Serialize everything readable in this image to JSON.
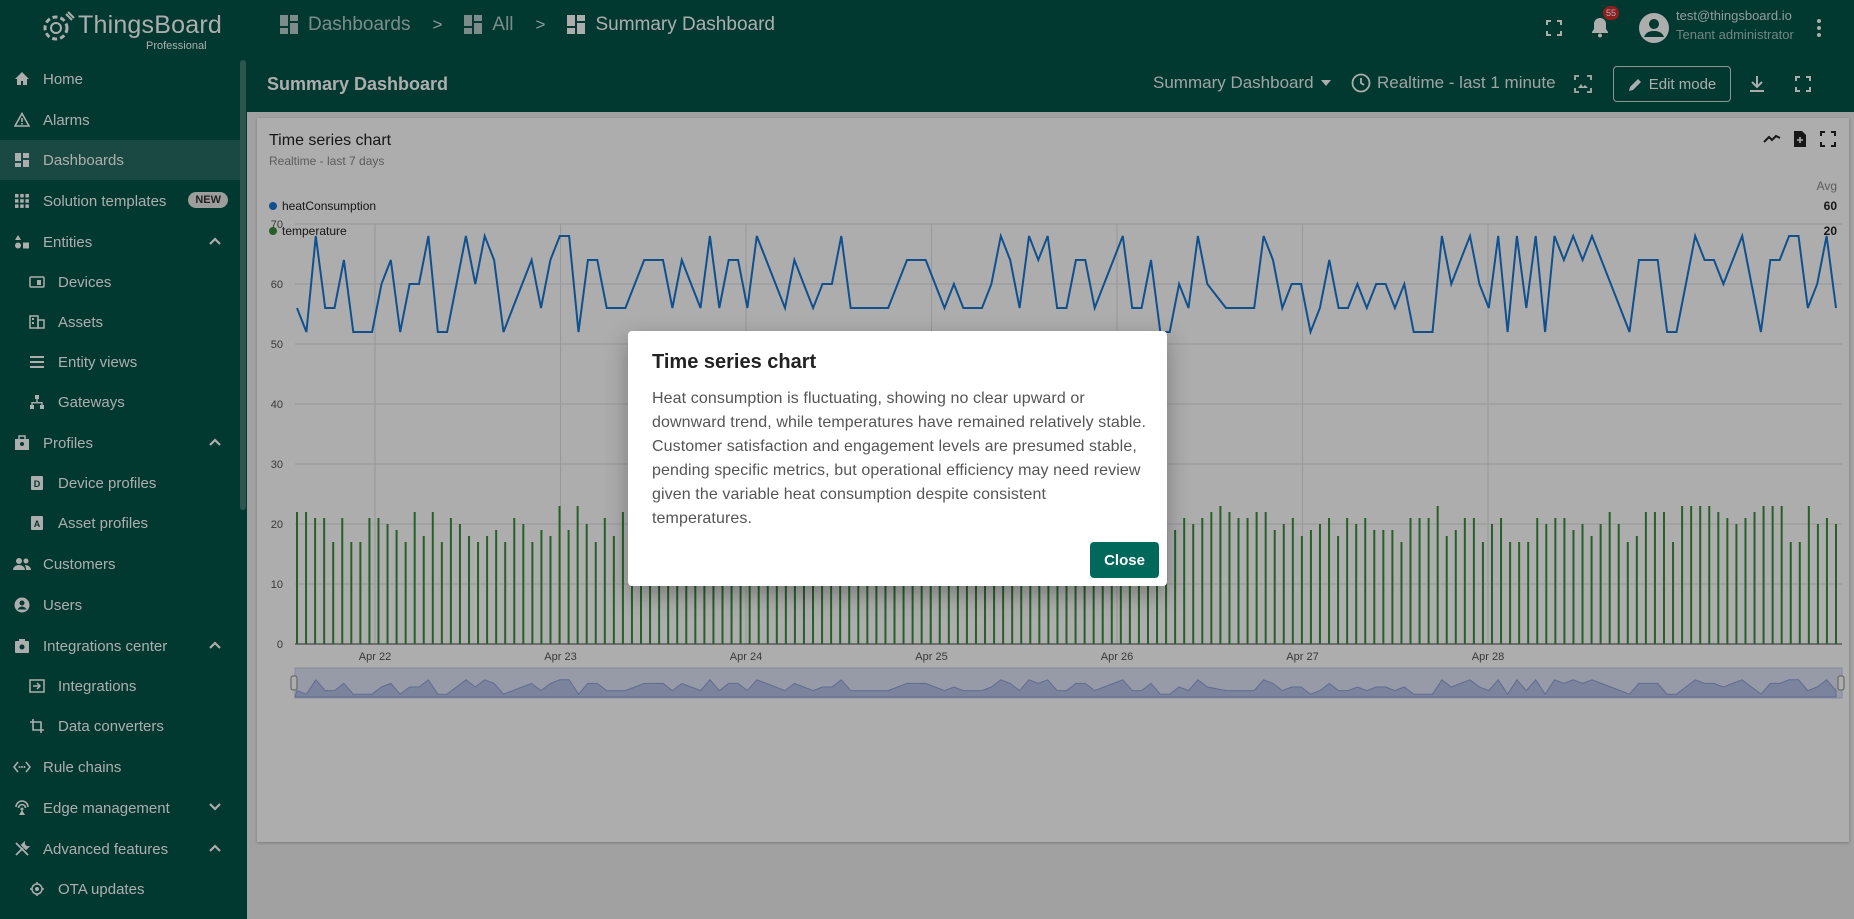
{
  "app": {
    "logo_name": "ThingsBoard",
    "logo_edition": "Professional"
  },
  "breadcrumbs": [
    "Dashboards",
    "All",
    "Summary Dashboard"
  ],
  "breadcrumb_separator": ">",
  "notifications": {
    "count": "55"
  },
  "user": {
    "email": "test@thingsboard.io",
    "role": "Tenant administrator"
  },
  "sidebar": {
    "items": [
      {
        "label": "Home",
        "icon": "home-icon"
      },
      {
        "label": "Alarms",
        "icon": "warning-icon"
      },
      {
        "label": "Dashboards",
        "icon": "dashboard-icon",
        "active": true
      },
      {
        "label": "Solution templates",
        "icon": "apps-icon",
        "badge": "NEW"
      },
      {
        "label": "Entities",
        "icon": "entities-icon",
        "expanded": true
      },
      {
        "label": "Devices",
        "icon": "devices-icon",
        "sub": true
      },
      {
        "label": "Assets",
        "icon": "assets-icon",
        "sub": true
      },
      {
        "label": "Entity views",
        "icon": "entity-views-icon",
        "sub": true
      },
      {
        "label": "Gateways",
        "icon": "gateway-icon",
        "sub": true
      },
      {
        "label": "Profiles",
        "icon": "profiles-icon",
        "expanded": true
      },
      {
        "label": "Device profiles",
        "icon": "device-profile-icon",
        "sub": true
      },
      {
        "label": "Asset profiles",
        "icon": "asset-profile-icon",
        "sub": true
      },
      {
        "label": "Customers",
        "icon": "customers-icon"
      },
      {
        "label": "Users",
        "icon": "user-icon"
      },
      {
        "label": "Integrations center",
        "icon": "integrations-center-icon",
        "expanded": true
      },
      {
        "label": "Integrations",
        "icon": "integrations-icon",
        "sub": true
      },
      {
        "label": "Data converters",
        "icon": "converter-icon",
        "sub": true
      },
      {
        "label": "Rule chains",
        "icon": "rule-chain-icon"
      },
      {
        "label": "Edge management",
        "icon": "edge-icon",
        "collapsed": true
      },
      {
        "label": "Advanced features",
        "icon": "tools-icon",
        "expanded": true
      },
      {
        "label": "OTA updates",
        "icon": "ota-icon",
        "sub": true
      }
    ]
  },
  "dashboard_header": {
    "title": "Summary Dashboard",
    "dashboard_select": "Summary Dashboard",
    "timewindow": "Realtime - last 1 minute",
    "edit_label": "Edit mode"
  },
  "widget": {
    "title": "Time series chart",
    "subtitle": "Realtime - last 7 days",
    "legend_header": "Avg",
    "legend": [
      {
        "name": "heatConsumption",
        "avg": "60",
        "color": "#1976d2"
      },
      {
        "name": "temperature",
        "avg": "20",
        "color": "#388e3c"
      }
    ]
  },
  "chart_data": {
    "type": "line",
    "ylim": [
      0,
      70
    ],
    "yticks": [
      0,
      10,
      20,
      30,
      40,
      50,
      60,
      70
    ],
    "xticks": [
      "Apr 22",
      "Apr 23",
      "Apr 24",
      "Apr 25",
      "Apr 26",
      "Apr 27",
      "Apr 28"
    ],
    "series": [
      {
        "name": "heatConsumption",
        "kind": "line",
        "color": "#1976d2",
        "values": [
          56,
          52,
          68,
          56,
          56,
          64,
          52,
          52,
          52,
          60,
          64,
          52,
          60,
          60,
          68,
          52,
          52,
          60,
          68,
          60,
          68,
          64,
          52,
          56,
          60,
          64,
          56,
          64,
          68,
          68,
          52,
          64,
          64,
          56,
          56,
          56,
          60,
          64,
          64,
          64,
          56,
          64,
          60,
          56,
          68,
          56,
          64,
          64,
          56,
          68,
          64,
          60,
          56,
          64,
          60,
          56,
          60,
          60,
          68,
          56,
          56,
          56,
          56,
          56,
          60,
          64,
          64,
          64,
          60,
          56,
          60,
          56,
          56,
          56,
          60,
          68,
          64,
          56,
          68,
          64,
          68,
          56,
          56,
          64,
          64,
          56,
          60,
          64,
          68,
          56,
          56,
          64,
          52,
          52,
          60,
          56,
          68,
          60,
          58,
          56,
          56,
          56,
          56,
          68,
          64,
          56,
          60,
          60,
          52,
          56,
          64,
          56,
          56,
          60,
          56,
          60,
          60,
          56,
          60,
          52,
          52,
          52,
          68,
          60,
          64,
          68,
          60,
          56,
          68,
          52,
          68,
          56,
          68,
          52,
          68,
          64,
          68,
          64,
          68,
          64,
          60,
          56,
          52,
          64,
          64,
          64,
          52,
          52,
          60,
          68,
          64,
          64,
          60,
          64,
          68,
          60,
          52,
          64,
          64,
          68,
          68,
          56,
          60,
          68,
          56
        ]
      },
      {
        "name": "temperature",
        "kind": "bar",
        "color": "#388e3c",
        "values": [
          22,
          22,
          21,
          21,
          17,
          21,
          17,
          17,
          21,
          21,
          20,
          19,
          17,
          22,
          18,
          22,
          17,
          21,
          20,
          18,
          17,
          18,
          19,
          17,
          21,
          20,
          17,
          19,
          18,
          23,
          19,
          23,
          20,
          17,
          21,
          18,
          22,
          19,
          23,
          18,
          17,
          18,
          17,
          17,
          21,
          20,
          21,
          18,
          20,
          22,
          23,
          19,
          21,
          22,
          20,
          20,
          21,
          18,
          17,
          23,
          19,
          20,
          19,
          23,
          17,
          18,
          20,
          17,
          21,
          17,
          18,
          18,
          17,
          21,
          20,
          19,
          21,
          20,
          21,
          19,
          17,
          20,
          21,
          17,
          22,
          23,
          22,
          17,
          22,
          23,
          19,
          19,
          23,
          22,
          23,
          20,
          19,
          19,
          21,
          20,
          21,
          22,
          23,
          22,
          21,
          21,
          22,
          22,
          19,
          20,
          21,
          18,
          19,
          20,
          21,
          18,
          21,
          20,
          21,
          19,
          19,
          19,
          17,
          21,
          21,
          21,
          23,
          18,
          19,
          21,
          21,
          17,
          20,
          21,
          17,
          17,
          17,
          21,
          20,
          21,
          21,
          19,
          20,
          18,
          20,
          22,
          20,
          17,
          18,
          22,
          22,
          22,
          17,
          23,
          23,
          23,
          23,
          22,
          21,
          20,
          21,
          22,
          23,
          23,
          23,
          17,
          17,
          23,
          20,
          21,
          20
        ]
      }
    ]
  },
  "dialog": {
    "title": "Time series chart",
    "text": "Heat consumption is fluctuating, showing no clear upward or downward trend, while temperatures have remained relatively stable. Customer satisfaction and engagement levels are presumed stable, pending specific metrics, but operational efficiency may need review given the variable heat consumption despite consistent temperatures.",
    "close_label": "Close"
  }
}
